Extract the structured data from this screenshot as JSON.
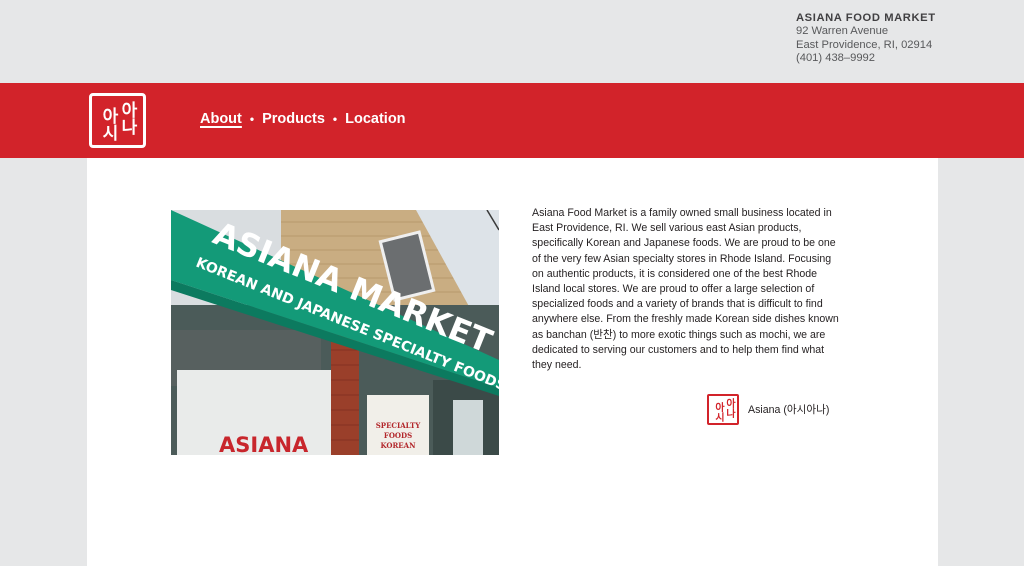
{
  "header": {
    "store_name": "ASIANA FOOD MARKET",
    "address_line1": "92 Warren Avenue",
    "address_line2": "East Providence, RI, 02914",
    "phone": "(401) 438–9992"
  },
  "logo": {
    "glyph_left": "아시",
    "glyph_right": "아나"
  },
  "nav": {
    "items": [
      {
        "label": "About",
        "active": true
      },
      {
        "label": "Products",
        "active": false
      },
      {
        "label": "Location",
        "active": false
      }
    ],
    "separator": "•"
  },
  "photo": {
    "awning_line1": "ASIANA MARKET",
    "awning_line2": "KOREAN AND JAPANESE SPECIALTY FOODS",
    "window_sign": "ASIANA",
    "poster_line1": "SPECIALTY",
    "poster_line2": "FOODS",
    "poster_line3": "KOREAN"
  },
  "about": {
    "body": "Asiana Food Market is a family owned small business located in East Providence, RI. We sell various east Asian products, specifically Korean and Japanese foods. We are proud to be one of the very few Asian specialty stores in Rhode Island. Focusing on authentic products, it is considered one of the best Rhode Island local stores. We are proud to offer a large selection of specialized foods and a variety of brands that is difficult to find anywhere else. From the freshly made Korean side dishes known as banchan (반찬) to more exotic things such as mochi, we are dedicated to serving our customers and to help them find what they need.",
    "signature": "Asiana (아시아나)"
  },
  "colors": {
    "brand_red": "#d2232a",
    "page_gray": "#e6e7e8",
    "awning_green": "#139a78"
  }
}
